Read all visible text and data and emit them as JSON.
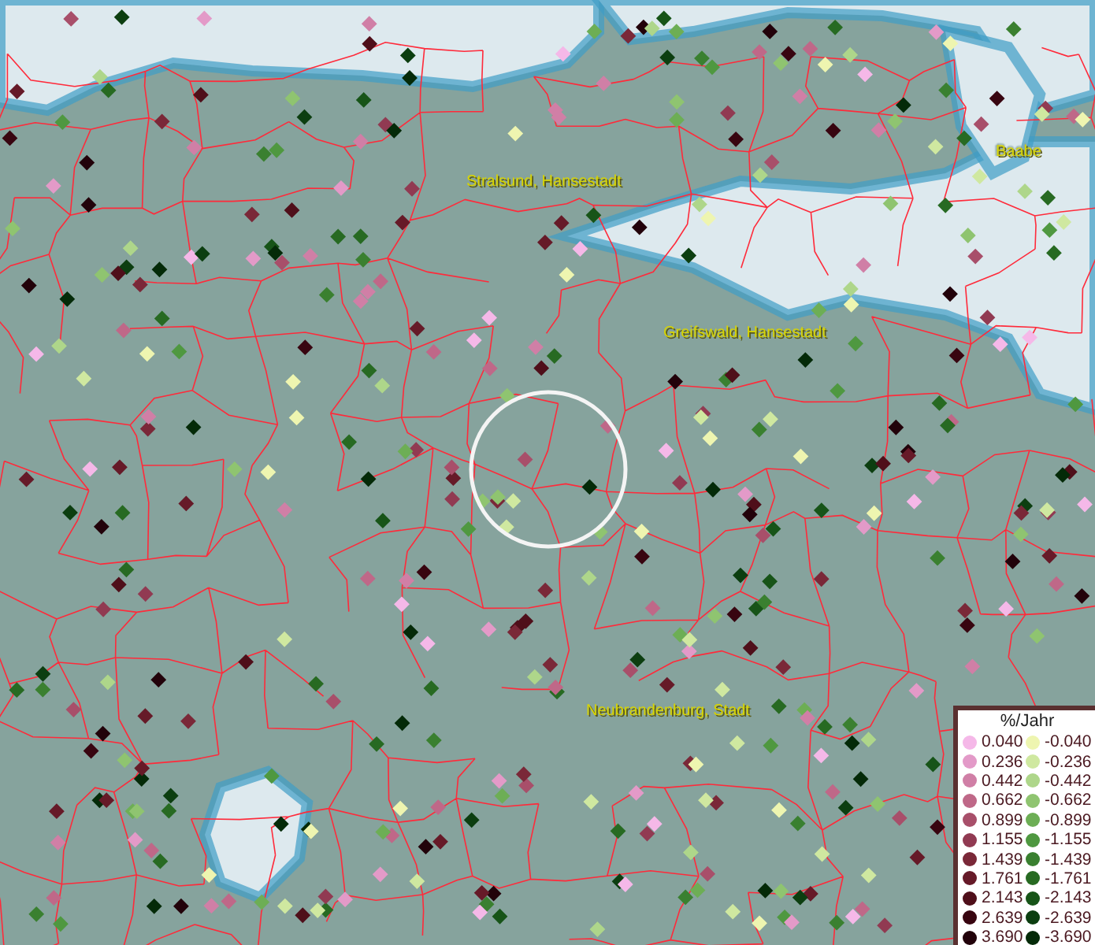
{
  "map": {
    "cities": [
      {
        "name": "Stralsund, Hansestadt"
      },
      {
        "name": "Greifswald, Hansestadt"
      },
      {
        "name": "Neubrandenburg, Stadt"
      },
      {
        "name": "Baabe"
      }
    ]
  },
  "legend": {
    "title": "%/Jahr",
    "columns": [
      [
        {
          "label": "0.040",
          "color": "#f5b8e8"
        },
        {
          "label": "0.236",
          "color": "#e39ac8"
        },
        {
          "label": "0.442",
          "color": "#d07fa6"
        },
        {
          "label": "0.662",
          "color": "#bf6888"
        },
        {
          "label": "0.899",
          "color": "#a84f6a"
        },
        {
          "label": "1.155",
          "color": "#913a52"
        },
        {
          "label": "1.439",
          "color": "#7a2838"
        },
        {
          "label": "1.761",
          "color": "#661a28"
        },
        {
          "label": "2.143",
          "color": "#4f0f1a"
        },
        {
          "label": "2.639",
          "color": "#380510"
        },
        {
          "label": "3.690",
          "color": "#22020a"
        }
      ],
      [
        {
          "label": "-0.040",
          "color": "#eef5b0"
        },
        {
          "label": "-0.236",
          "color": "#cfe8a0"
        },
        {
          "label": "-0.442",
          "color": "#aed68a"
        },
        {
          "label": "-0.662",
          "color": "#8fc470"
        },
        {
          "label": "-0.899",
          "color": "#6dae55"
        },
        {
          "label": "-1.155",
          "color": "#4f9840"
        },
        {
          "label": "-1.439",
          "color": "#3a8030"
        },
        {
          "label": "-1.761",
          "color": "#276a22"
        },
        {
          "label": "-2.143",
          "color": "#175418"
        },
        {
          "label": "-2.639",
          "color": "#0c3e10"
        },
        {
          "label": "-3.690",
          "color": "#042a08"
        }
      ]
    ]
  }
}
